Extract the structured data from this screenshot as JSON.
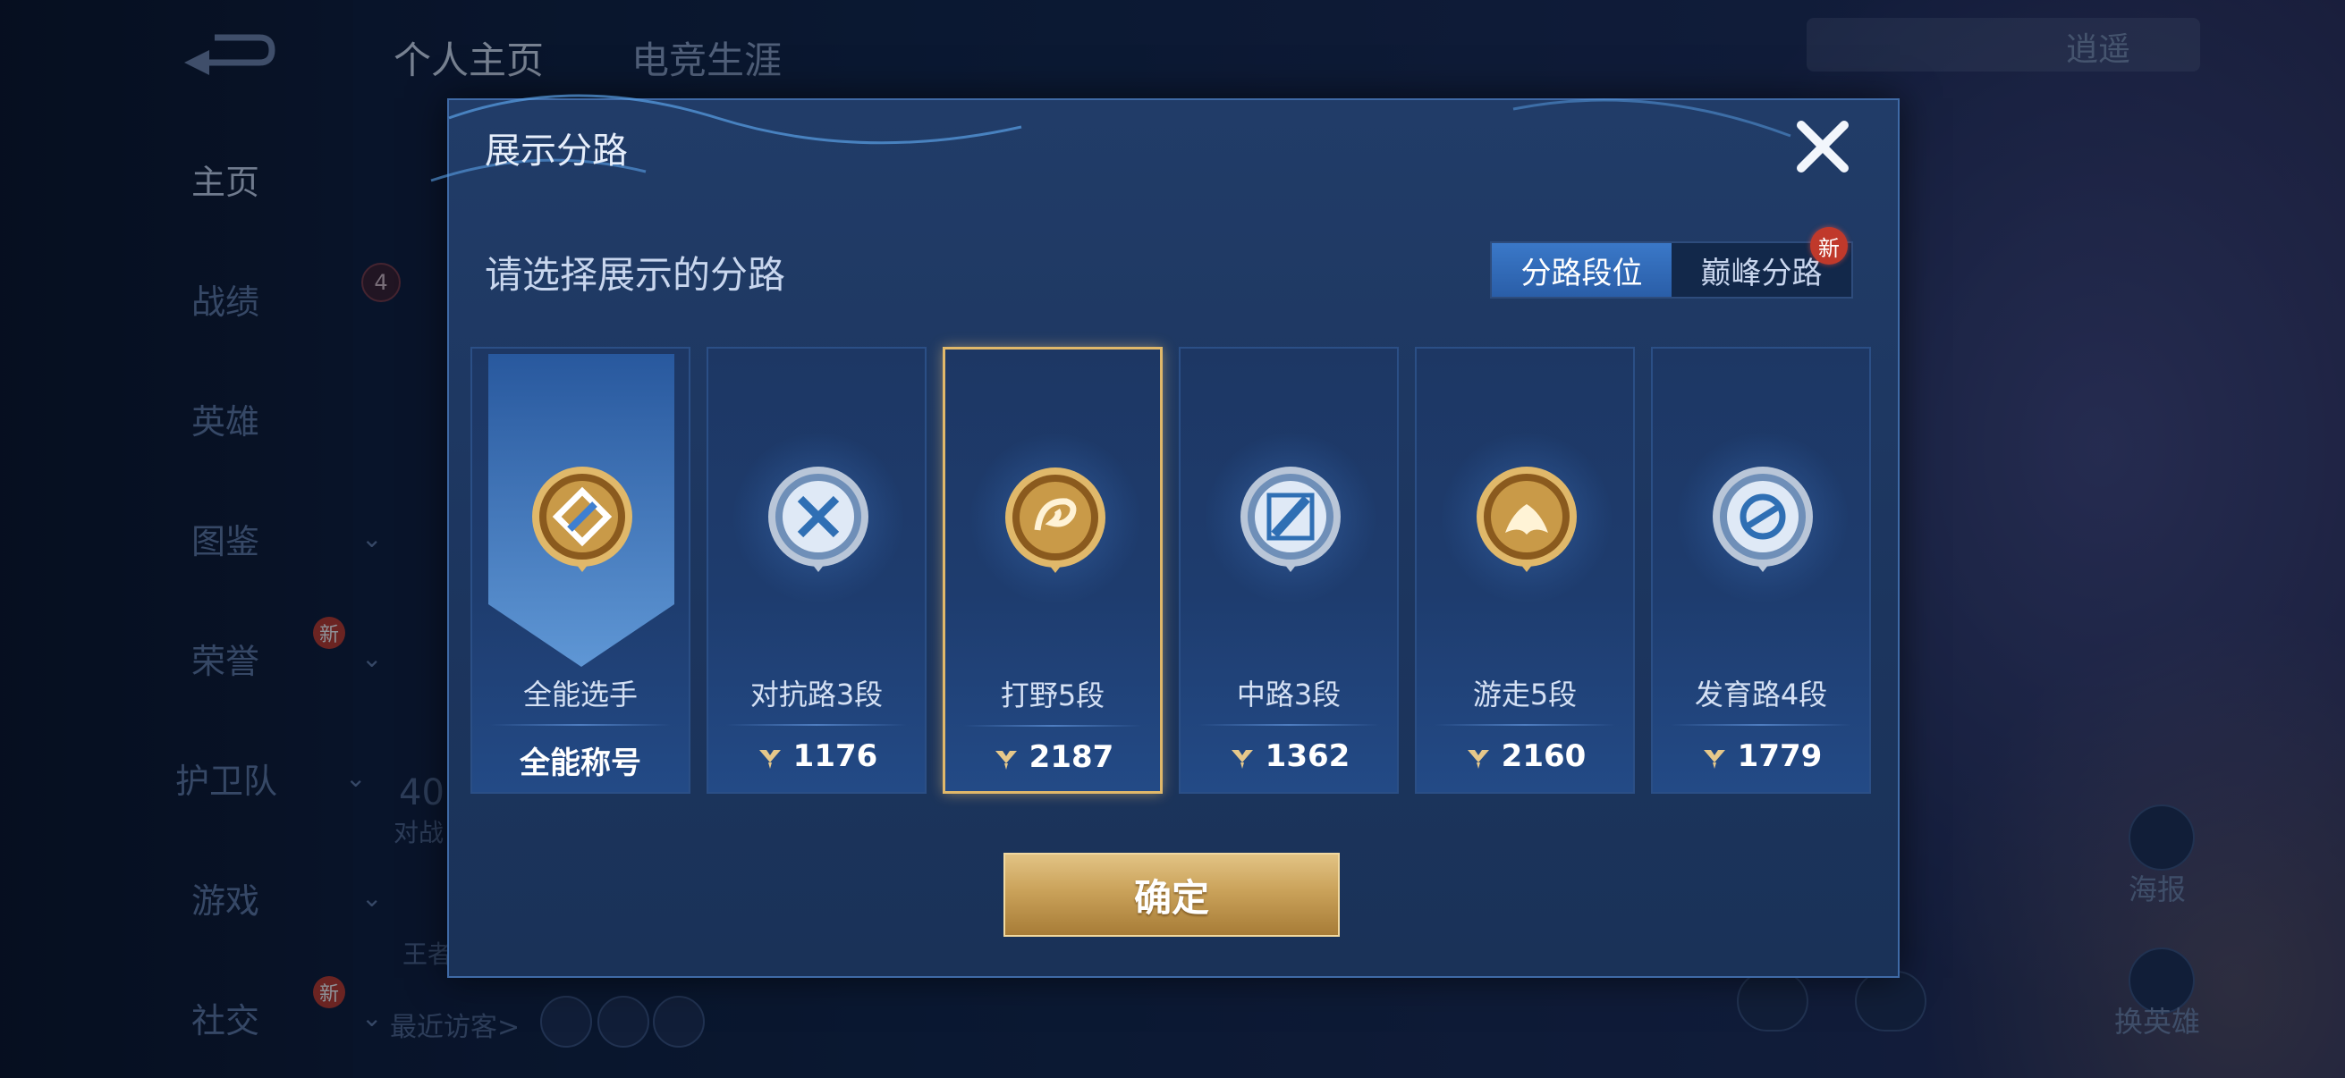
{
  "background": {
    "top_tabs": [
      "个人主页",
      "电竞生涯"
    ],
    "sidebar": [
      {
        "label": "主页",
        "active": true,
        "chevron": false,
        "new": false
      },
      {
        "label": "战绩",
        "active": false,
        "chevron": false,
        "new": false
      },
      {
        "label": "英雄",
        "active": false,
        "chevron": false,
        "new": false
      },
      {
        "label": "图鉴",
        "active": false,
        "chevron": true,
        "new": false
      },
      {
        "label": "荣誉",
        "active": false,
        "chevron": true,
        "new": true
      },
      {
        "label": "护卫队",
        "active": false,
        "chevron": true,
        "new": false
      },
      {
        "label": "游戏",
        "active": false,
        "chevron": true,
        "new": false
      },
      {
        "label": "社交",
        "active": false,
        "chevron": true,
        "new": true
      }
    ],
    "new_badge": "新",
    "avatar_badge": "4",
    "stat_value": "40",
    "stat_label": "对战",
    "partial_text": "王者",
    "recent_visitors": "最近访客>",
    "top_right_text": "逍遥",
    "right_actions": [
      "海报",
      "换英雄"
    ]
  },
  "dialog": {
    "title": "展示分路",
    "subtitle": "请选择展示的分路",
    "toggle": {
      "options": [
        "分路段位",
        "巅峰分路"
      ],
      "active": 0
    },
    "new_badge": "新",
    "confirm_label": "确定",
    "cards": [
      {
        "label": "全能选手",
        "score": "全能称号",
        "medal": "all-round-medal",
        "selected": false,
        "has_pin": false
      },
      {
        "label": "对抗路3段",
        "score": "1176",
        "medal": "clash-lane-medal",
        "selected": false,
        "has_pin": true
      },
      {
        "label": "打野5段",
        "score": "2187",
        "medal": "jungle-dragon-medal",
        "selected": true,
        "has_pin": true
      },
      {
        "label": "中路3段",
        "score": "1362",
        "medal": "mid-lane-medal",
        "selected": false,
        "has_pin": true
      },
      {
        "label": "游走5段",
        "score": "2160",
        "medal": "roam-wings-medal",
        "selected": false,
        "has_pin": true
      },
      {
        "label": "发育路4段",
        "score": "1779",
        "medal": "farm-lane-medal",
        "selected": false,
        "has_pin": true
      }
    ],
    "colors": {
      "gold": "#e0b86a",
      "silver": "#b9c6d8",
      "accent": "#3a78c8"
    }
  }
}
